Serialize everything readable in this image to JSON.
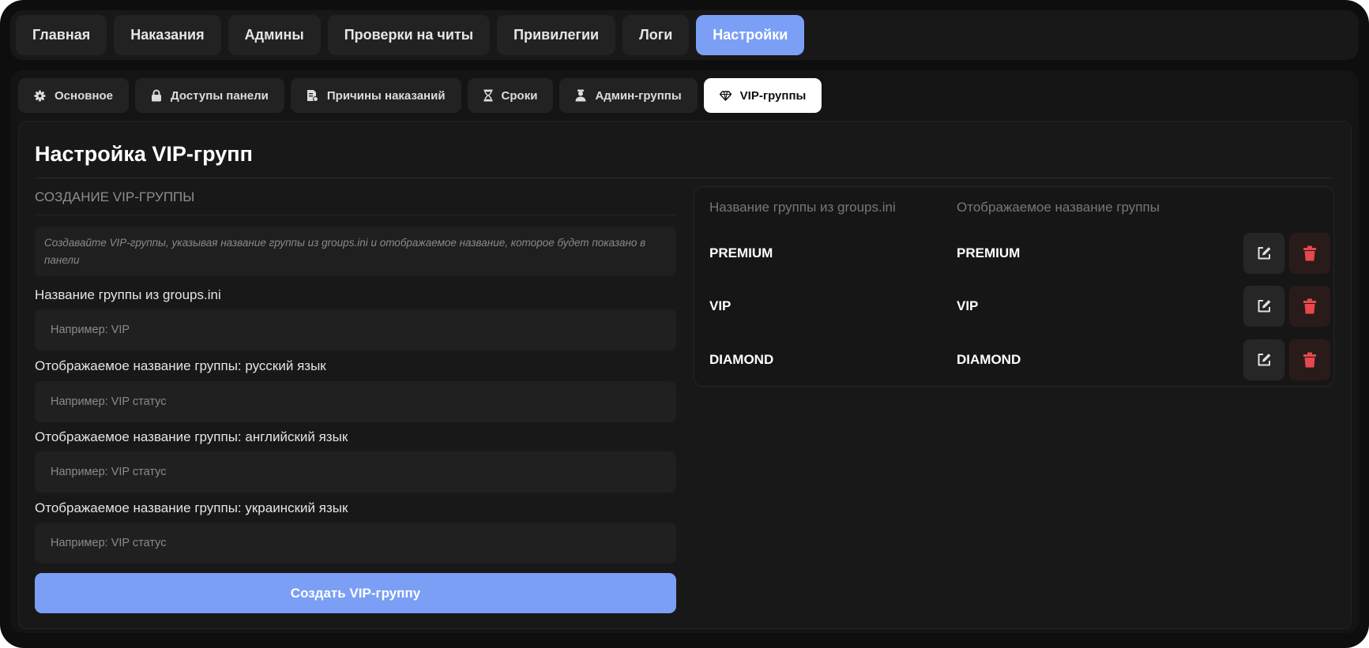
{
  "top_nav": {
    "tabs": [
      {
        "label": "Главная"
      },
      {
        "label": "Наказания"
      },
      {
        "label": "Админы"
      },
      {
        "label": "Проверки на читы"
      },
      {
        "label": "Привилегии"
      },
      {
        "label": "Логи"
      },
      {
        "label": "Настройки"
      }
    ],
    "active": "Настройки",
    "accent_color": "#7b9ff5"
  },
  "settings_tabs": {
    "tabs": [
      {
        "label": "Основное",
        "icon": "gear-icon"
      },
      {
        "label": "Доступы панели",
        "icon": "lock-icon"
      },
      {
        "label": "Причины наказаний",
        "icon": "document-icon"
      },
      {
        "label": "Сроки",
        "icon": "hourglass-icon"
      },
      {
        "label": "Админ-группы",
        "icon": "admin-user-icon"
      },
      {
        "label": "VIP-группы",
        "icon": "diamond-icon"
      }
    ],
    "active": "VIP-группы"
  },
  "page": {
    "title": "Настройка VIP-групп"
  },
  "form": {
    "section_caption": "СОЗДАНИЕ VIP-ГРУППЫ",
    "hint": "Создавайте VIP-группы, указывая название группы из groups.ini и отображаемое название, которое будет показано в панели",
    "group_name": {
      "label": "Название группы из groups.ini",
      "value": "",
      "placeholder": "Например: VIP"
    },
    "display_ru": {
      "label": "Отображаемое название группы: русский язык",
      "value": "",
      "placeholder": "Например: VIP статус"
    },
    "display_en": {
      "label": "Отображаемое название группы: английский язык",
      "value": "",
      "placeholder": "Например: VIP статус"
    },
    "display_uk": {
      "label": "Отображаемое название группы: украинский язык",
      "value": "",
      "placeholder": "Например: VIP статус"
    },
    "submit_label": "Создать VIP-группу"
  },
  "groups_table": {
    "columns": [
      "Название группы из groups.ini",
      "Отображаемое название группы"
    ],
    "rows": [
      {
        "group": "PREMIUM",
        "display": "PREMIUM"
      },
      {
        "group": "VIP",
        "display": "VIP"
      },
      {
        "group": "DIAMOND",
        "display": "DIAMOND"
      }
    ],
    "row_actions": [
      "edit-icon",
      "trash-icon"
    ],
    "delete_color": "#e5484d"
  }
}
